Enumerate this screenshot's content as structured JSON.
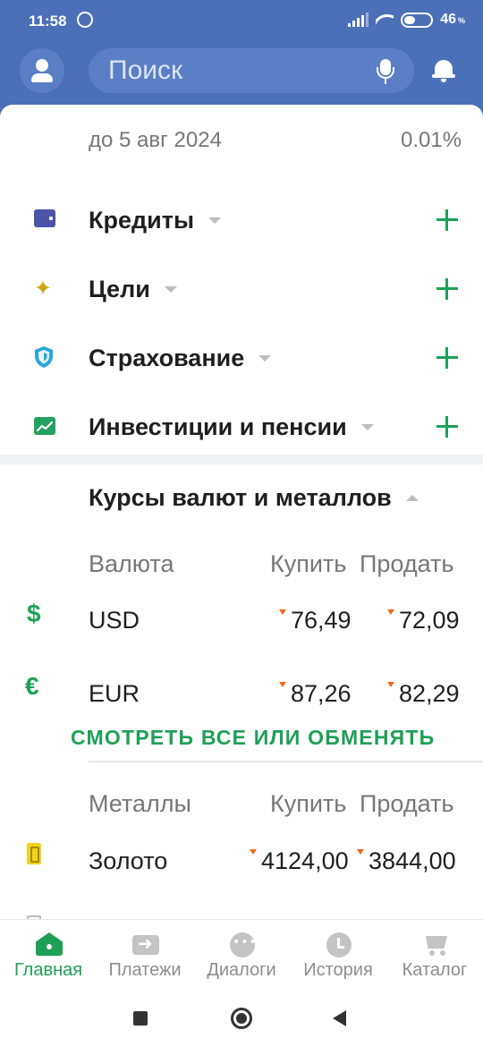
{
  "status_bar": {
    "time": "11:58",
    "battery": "46",
    "battery_unit": "%"
  },
  "search": {
    "placeholder": "Поиск"
  },
  "deposit": {
    "until": "до 5 авг 2024",
    "rate": "0.01%"
  },
  "products": [
    {
      "title": "Кредиты",
      "icon": "wallet-icon"
    },
    {
      "title": "Цели",
      "icon": "star-icon"
    },
    {
      "title": "Страхование",
      "icon": "shield-icon"
    },
    {
      "title": "Инвестиции и пенсии",
      "icon": "chart-icon"
    }
  ],
  "rates": {
    "title": "Курсы валют и металлов",
    "currency_header": {
      "name": "Валюта",
      "buy": "Купить",
      "sell": "Продать"
    },
    "currencies": [
      {
        "code": "USD",
        "icon": "dollar-icon",
        "buy": "76,49",
        "sell": "72,09"
      },
      {
        "code": "EUR",
        "icon": "euro-icon",
        "buy": "87,26",
        "sell": "82,29"
      }
    ],
    "link": "СМОТРЕТЬ ВСЕ ИЛИ ОБМЕНЯТЬ",
    "metals_header": {
      "name": "Металлы",
      "buy": "Купить",
      "sell": "Продать"
    },
    "metals": [
      {
        "name": "Золото",
        "icon": "gold-bar-icon",
        "buy": "4124,00",
        "sell": "3844,00"
      }
    ],
    "trend_color": "#f06a1d"
  },
  "bottom_nav": [
    {
      "label": "Главная",
      "icon": "home-icon",
      "active": true
    },
    {
      "label": "Платежи",
      "icon": "transfer-icon",
      "active": false
    },
    {
      "label": "Диалоги",
      "icon": "chat-icon",
      "active": false
    },
    {
      "label": "История",
      "icon": "clock-icon",
      "active": false
    },
    {
      "label": "Каталог",
      "icon": "cart-icon",
      "active": false
    }
  ],
  "colors": {
    "header_bg": "#4a70b8",
    "accent": "#1ea055"
  }
}
